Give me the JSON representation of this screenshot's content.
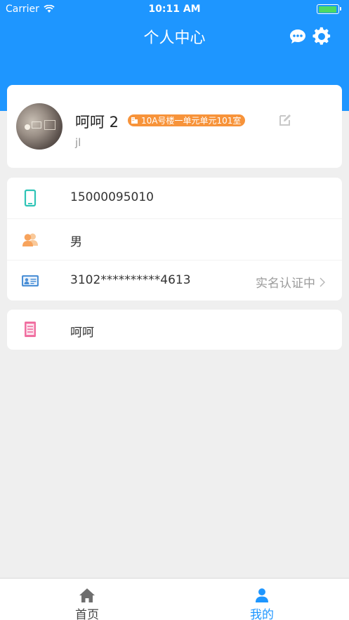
{
  "status_bar": {
    "carrier": "Carrier",
    "time": "10:11 AM",
    "battery_color": "#4cd964"
  },
  "header": {
    "title": "个人中心",
    "icons": [
      "chat-bubble-icon",
      "gear-icon"
    ],
    "background": "#1e96ff"
  },
  "profile": {
    "name": "呵呵 2",
    "address_badge": "10A号楼一单元单元101室",
    "subtitle": "jl",
    "badge_color": "#f7933a"
  },
  "info": {
    "phone": "15000095010",
    "gender": "男",
    "id_number": "3102**********4613",
    "id_status": "实名认证中",
    "note": "呵呵"
  },
  "tabbar": {
    "tabs": [
      {
        "label": "首页",
        "icon": "home-icon",
        "active": false
      },
      {
        "label": "我的",
        "icon": "user-icon",
        "active": true
      }
    ]
  }
}
